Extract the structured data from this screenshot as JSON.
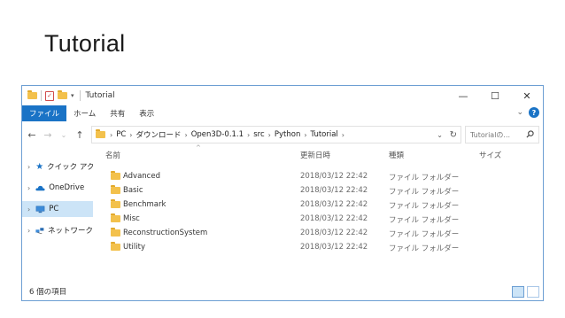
{
  "slide": {
    "title": "Tutorial"
  },
  "window": {
    "title": "Tutorial",
    "controls": [
      "—",
      "☐",
      "✕"
    ]
  },
  "ribbon": {
    "tabs": [
      "ファイル",
      "ホーム",
      "共有",
      "表示"
    ],
    "help": "?"
  },
  "address": {
    "crumbs": [
      "PC",
      "ダウンロード",
      "Open3D-0.1.1",
      "src",
      "Python",
      "Tutorial"
    ],
    "search_placeholder": "Tutorialの..."
  },
  "nav": {
    "items": [
      {
        "label": "クイック アクセス",
        "icon": "star-icon"
      },
      {
        "label": "OneDrive",
        "icon": "cloud-icon"
      },
      {
        "label": "PC",
        "icon": "pc-icon",
        "selected": true
      },
      {
        "label": "ネットワーク",
        "icon": "network-icon"
      }
    ]
  },
  "list": {
    "columns": [
      "名前",
      "更新日時",
      "種類",
      "サイズ"
    ],
    "rows": [
      {
        "name": "Advanced",
        "date": "2018/03/12 22:42",
        "type": "ファイル フォルダー"
      },
      {
        "name": "Basic",
        "date": "2018/03/12 22:42",
        "type": "ファイル フォルダー"
      },
      {
        "name": "Benchmark",
        "date": "2018/03/12 22:42",
        "type": "ファイル フォルダー"
      },
      {
        "name": "Misc",
        "date": "2018/03/12 22:42",
        "type": "ファイル フォルダー"
      },
      {
        "name": "ReconstructionSystem",
        "date": "2018/03/12 22:42",
        "type": "ファイル フォルダー"
      },
      {
        "name": "Utility",
        "date": "2018/03/12 22:42",
        "type": "ファイル フォルダー"
      }
    ]
  },
  "status": {
    "count": "6 個の項目"
  },
  "colors": {
    "accent": "#1a73c6",
    "folder": "#f3c14c",
    "selection": "#cce4f7"
  }
}
